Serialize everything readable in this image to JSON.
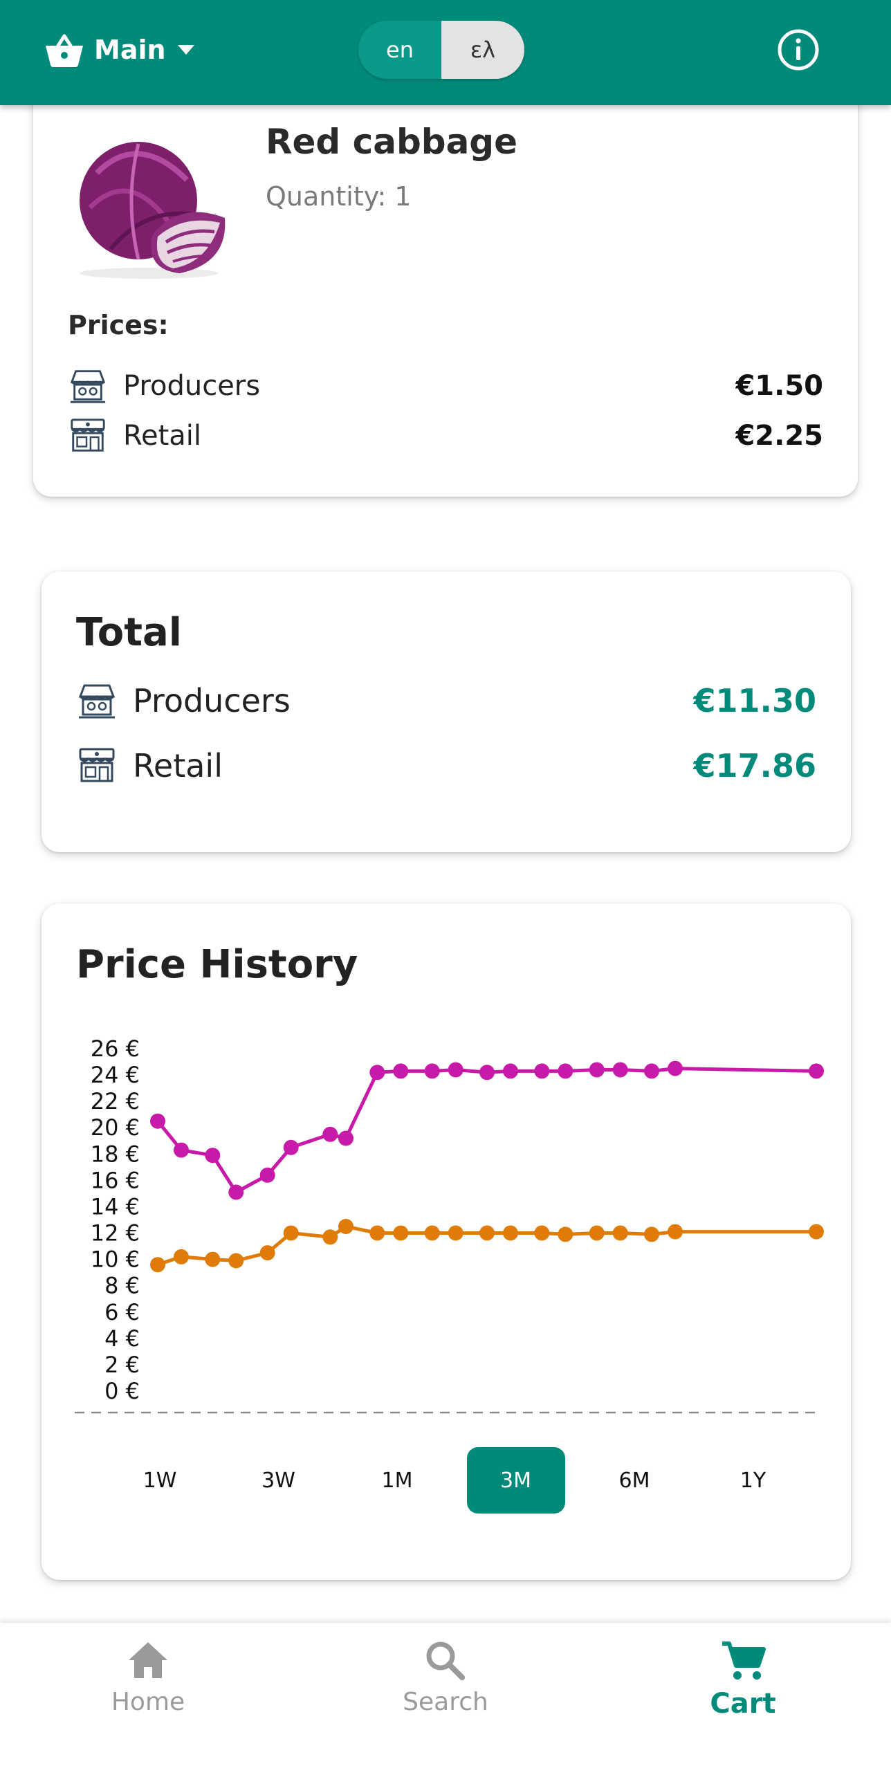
{
  "header": {
    "list_name": "Main",
    "language_options": [
      "en",
      "ελ"
    ],
    "active_language": "en"
  },
  "item": {
    "name": "Red cabbage",
    "quantity_text": "Quantity: 1",
    "prices_label": "Prices:",
    "prices": [
      {
        "label": "Producers",
        "value": "€1.50",
        "icon": "farmers-market-icon"
      },
      {
        "label": "Retail",
        "value": "€2.25",
        "icon": "retail-store-icon"
      }
    ]
  },
  "total": {
    "title": "Total",
    "rows": [
      {
        "label": "Producers",
        "value": "€11.30",
        "icon": "farmers-market-icon"
      },
      {
        "label": "Retail",
        "value": "€17.86",
        "icon": "retail-store-icon"
      }
    ]
  },
  "history": {
    "title": "Price History",
    "ranges": [
      "1W",
      "3W",
      "1M",
      "3M",
      "6M",
      "1Y"
    ],
    "active_range": "3M"
  },
  "chart_data": {
    "type": "line",
    "title": "Price History",
    "ylim": [
      0,
      26
    ],
    "y_ticks": [
      "0 €",
      "2 €",
      "4 €",
      "6 €",
      "8 €",
      "10 €",
      "12 €",
      "14 €",
      "16 €",
      "18 €",
      "20 €",
      "22 €",
      "24 €",
      "26 €"
    ],
    "x": [
      0,
      3,
      7,
      10,
      14,
      17,
      22,
      24,
      28,
      31,
      35,
      38,
      42,
      45,
      49,
      52,
      56,
      59,
      63,
      66,
      70,
      73,
      84
    ],
    "x_axis_dashed": true,
    "series": [
      {
        "color": "#c71aa8",
        "values": [
          20.5,
          18.3,
          17.9,
          15.1,
          16.4,
          18.5,
          19.5,
          19.2,
          24.2,
          24.3,
          24.3,
          24.4,
          24.2,
          24.3,
          24.3,
          24.3,
          24.4,
          24.4,
          24.3,
          24.5,
          null,
          null,
          24.3
        ]
      },
      {
        "color": "#e07b08",
        "values": [
          9.6,
          10.2,
          10.0,
          9.9,
          10.5,
          12.0,
          11.7,
          12.5,
          12.0,
          12.0,
          12.0,
          12.0,
          12.0,
          12.0,
          12.0,
          11.9,
          12.0,
          12.0,
          11.9,
          12.1,
          null,
          null,
          12.1
        ]
      }
    ]
  },
  "nav": {
    "items": [
      {
        "label": "Home",
        "icon": "home-icon"
      },
      {
        "label": "Search",
        "icon": "search-icon"
      },
      {
        "label": "Cart",
        "icon": "cart-icon"
      }
    ],
    "active": "Cart"
  },
  "colors": {
    "primary": "#008a7a",
    "series_retail": "#c71aa8",
    "series_producers": "#e07b08"
  }
}
